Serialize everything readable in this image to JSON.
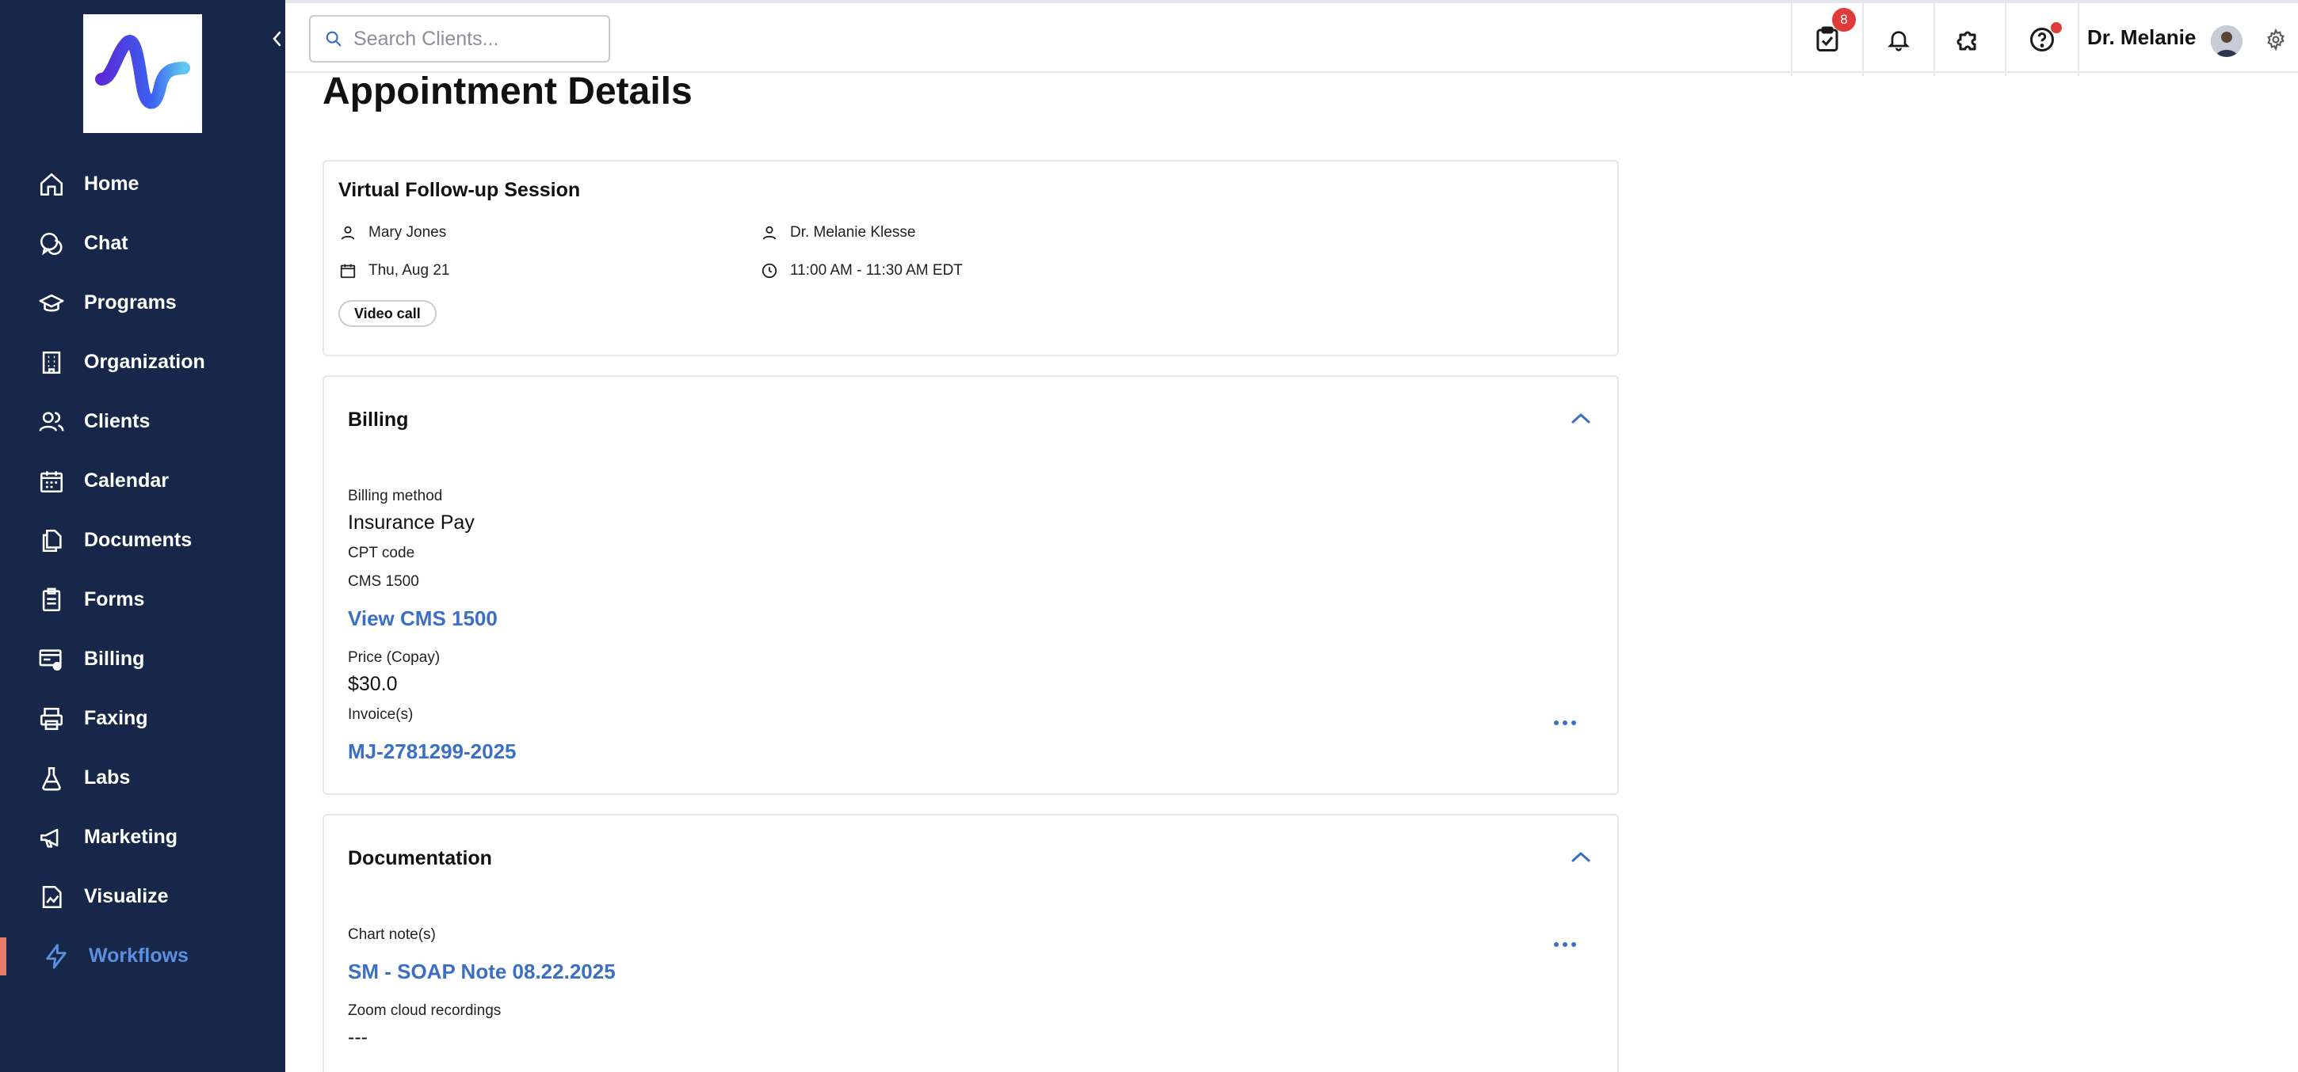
{
  "sidebar": {
    "items": [
      {
        "label": "Home",
        "icon": "home-icon"
      },
      {
        "label": "Chat",
        "icon": "chat-icon"
      },
      {
        "label": "Programs",
        "icon": "graduation-cap-icon"
      },
      {
        "label": "Organization",
        "icon": "building-icon"
      },
      {
        "label": "Clients",
        "icon": "users-icon"
      },
      {
        "label": "Calendar",
        "icon": "calendar-icon"
      },
      {
        "label": "Documents",
        "icon": "documents-icon"
      },
      {
        "label": "Forms",
        "icon": "clipboard-icon"
      },
      {
        "label": "Billing",
        "icon": "billing-icon"
      },
      {
        "label": "Faxing",
        "icon": "printer-icon"
      },
      {
        "label": "Labs",
        "icon": "flask-icon"
      },
      {
        "label": "Marketing",
        "icon": "megaphone-icon"
      },
      {
        "label": "Visualize",
        "icon": "chart-file-icon"
      },
      {
        "label": "Workflows",
        "icon": "lightning-icon",
        "active": true
      }
    ]
  },
  "topbar": {
    "search_placeholder": "Search Clients...",
    "tasks_badge": "8",
    "user_name": "Dr. Melanie"
  },
  "page": {
    "title": "Appointment Details"
  },
  "appointment": {
    "title": "Virtual Follow-up Session",
    "client": "Mary Jones",
    "provider": "Dr. Melanie Klesse",
    "date": "Thu, Aug 21",
    "time": "11:00 AM - 11:30 AM EDT",
    "type": "Video call"
  },
  "billing": {
    "heading": "Billing",
    "method_label": "Billing method",
    "method_value": "Insurance Pay",
    "cpt_label": "CPT code",
    "cms_label": "CMS 1500",
    "cms_link": "View CMS 1500",
    "price_label": "Price (Copay)",
    "price_value": "$30.0",
    "invoice_label": "Invoice(s)",
    "invoice_link": "MJ-2781299-2025"
  },
  "documentation": {
    "heading": "Documentation",
    "chart_label": "Chart note(s)",
    "chart_link": "SM - SOAP Note 08.22.2025",
    "zoom_label": "Zoom cloud recordings",
    "zoom_value": "---"
  },
  "colors": {
    "sidebar_bg": "#17274a",
    "accent": "#3b6fc4",
    "active_marker": "#e87a6c",
    "badge": "#e03b3b"
  }
}
